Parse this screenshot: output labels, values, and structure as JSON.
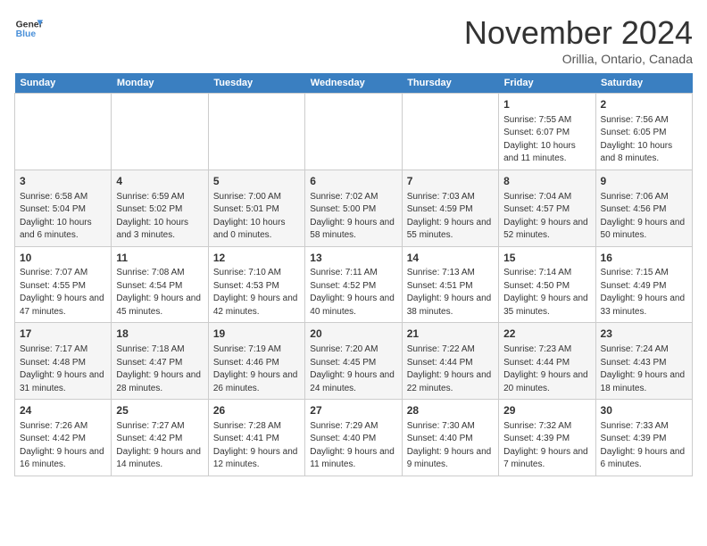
{
  "header": {
    "logo_line1": "General",
    "logo_line2": "Blue",
    "month": "November 2024",
    "location": "Orillia, Ontario, Canada"
  },
  "weekdays": [
    "Sunday",
    "Monday",
    "Tuesday",
    "Wednesday",
    "Thursday",
    "Friday",
    "Saturday"
  ],
  "weeks": [
    [
      {
        "day": "",
        "empty": true
      },
      {
        "day": "",
        "empty": true
      },
      {
        "day": "",
        "empty": true
      },
      {
        "day": "",
        "empty": true
      },
      {
        "day": "",
        "empty": true
      },
      {
        "day": "1",
        "sunrise": "7:55 AM",
        "sunset": "6:07 PM",
        "daylight": "10 hours and 11 minutes."
      },
      {
        "day": "2",
        "sunrise": "7:56 AM",
        "sunset": "6:05 PM",
        "daylight": "10 hours and 8 minutes."
      }
    ],
    [
      {
        "day": "3",
        "sunrise": "6:58 AM",
        "sunset": "5:04 PM",
        "daylight": "10 hours and 6 minutes."
      },
      {
        "day": "4",
        "sunrise": "6:59 AM",
        "sunset": "5:02 PM",
        "daylight": "10 hours and 3 minutes."
      },
      {
        "day": "5",
        "sunrise": "7:00 AM",
        "sunset": "5:01 PM",
        "daylight": "10 hours and 0 minutes."
      },
      {
        "day": "6",
        "sunrise": "7:02 AM",
        "sunset": "5:00 PM",
        "daylight": "9 hours and 58 minutes."
      },
      {
        "day": "7",
        "sunrise": "7:03 AM",
        "sunset": "4:59 PM",
        "daylight": "9 hours and 55 minutes."
      },
      {
        "day": "8",
        "sunrise": "7:04 AM",
        "sunset": "4:57 PM",
        "daylight": "9 hours and 52 minutes."
      },
      {
        "day": "9",
        "sunrise": "7:06 AM",
        "sunset": "4:56 PM",
        "daylight": "9 hours and 50 minutes."
      }
    ],
    [
      {
        "day": "10",
        "sunrise": "7:07 AM",
        "sunset": "4:55 PM",
        "daylight": "9 hours and 47 minutes."
      },
      {
        "day": "11",
        "sunrise": "7:08 AM",
        "sunset": "4:54 PM",
        "daylight": "9 hours and 45 minutes."
      },
      {
        "day": "12",
        "sunrise": "7:10 AM",
        "sunset": "4:53 PM",
        "daylight": "9 hours and 42 minutes."
      },
      {
        "day": "13",
        "sunrise": "7:11 AM",
        "sunset": "4:52 PM",
        "daylight": "9 hours and 40 minutes."
      },
      {
        "day": "14",
        "sunrise": "7:13 AM",
        "sunset": "4:51 PM",
        "daylight": "9 hours and 38 minutes."
      },
      {
        "day": "15",
        "sunrise": "7:14 AM",
        "sunset": "4:50 PM",
        "daylight": "9 hours and 35 minutes."
      },
      {
        "day": "16",
        "sunrise": "7:15 AM",
        "sunset": "4:49 PM",
        "daylight": "9 hours and 33 minutes."
      }
    ],
    [
      {
        "day": "17",
        "sunrise": "7:17 AM",
        "sunset": "4:48 PM",
        "daylight": "9 hours and 31 minutes."
      },
      {
        "day": "18",
        "sunrise": "7:18 AM",
        "sunset": "4:47 PM",
        "daylight": "9 hours and 28 minutes."
      },
      {
        "day": "19",
        "sunrise": "7:19 AM",
        "sunset": "4:46 PM",
        "daylight": "9 hours and 26 minutes."
      },
      {
        "day": "20",
        "sunrise": "7:20 AM",
        "sunset": "4:45 PM",
        "daylight": "9 hours and 24 minutes."
      },
      {
        "day": "21",
        "sunrise": "7:22 AM",
        "sunset": "4:44 PM",
        "daylight": "9 hours and 22 minutes."
      },
      {
        "day": "22",
        "sunrise": "7:23 AM",
        "sunset": "4:44 PM",
        "daylight": "9 hours and 20 minutes."
      },
      {
        "day": "23",
        "sunrise": "7:24 AM",
        "sunset": "4:43 PM",
        "daylight": "9 hours and 18 minutes."
      }
    ],
    [
      {
        "day": "24",
        "sunrise": "7:26 AM",
        "sunset": "4:42 PM",
        "daylight": "9 hours and 16 minutes."
      },
      {
        "day": "25",
        "sunrise": "7:27 AM",
        "sunset": "4:42 PM",
        "daylight": "9 hours and 14 minutes."
      },
      {
        "day": "26",
        "sunrise": "7:28 AM",
        "sunset": "4:41 PM",
        "daylight": "9 hours and 12 minutes."
      },
      {
        "day": "27",
        "sunrise": "7:29 AM",
        "sunset": "4:40 PM",
        "daylight": "9 hours and 11 minutes."
      },
      {
        "day": "28",
        "sunrise": "7:30 AM",
        "sunset": "4:40 PM",
        "daylight": "9 hours and 9 minutes."
      },
      {
        "day": "29",
        "sunrise": "7:32 AM",
        "sunset": "4:39 PM",
        "daylight": "9 hours and 7 minutes."
      },
      {
        "day": "30",
        "sunrise": "7:33 AM",
        "sunset": "4:39 PM",
        "daylight": "9 hours and 6 minutes."
      }
    ]
  ]
}
